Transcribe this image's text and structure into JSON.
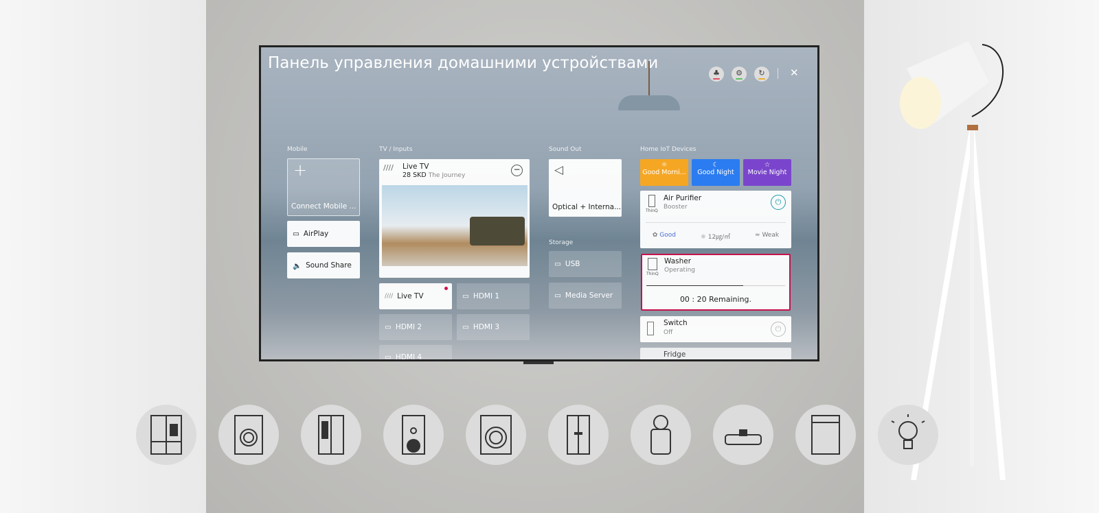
{
  "header": {
    "title": "Панель управления домашними устройствами",
    "icons": [
      {
        "name": "user-settings-icon",
        "color": "#e05060"
      },
      {
        "name": "gear-icon",
        "color": "#5cc060"
      },
      {
        "name": "refresh-icon",
        "color": "#e8b030"
      }
    ],
    "close": "✕"
  },
  "mobile": {
    "label": "Mobile",
    "connect": "Connect Mobile ...",
    "airplay": "AirPlay",
    "sound_share": "Sound Share"
  },
  "tv": {
    "label": "TV / Inputs",
    "live_title": "Live TV",
    "channel": "28 SKD",
    "program": "The Journey",
    "inputs": [
      "Live TV",
      "HDMI 1",
      "HDMI 2",
      "HDMI 3",
      "HDMI 4"
    ],
    "active_dot_color": "#d0104c"
  },
  "sound": {
    "label": "Sound Out",
    "output": "Optical + Interna..."
  },
  "storage": {
    "label": "Storage",
    "items": [
      "USB",
      "Media Server"
    ]
  },
  "iot": {
    "label": "Home IoT Devices",
    "scenes": [
      {
        "label": "Good Morni...",
        "color": "#f5a623",
        "icon": "sun-icon"
      },
      {
        "label": "Good Night",
        "color": "#2b7cf0",
        "icon": "moon-icon"
      },
      {
        "label": "Movie Night",
        "color": "#7a45cc",
        "icon": "star-icon"
      }
    ],
    "air_purifier": {
      "name": "Air Purifier",
      "mode": "Booster",
      "quality": "Good",
      "pm": "12㎍/㎥",
      "fan": "Weak",
      "thinq": "ThinQ"
    },
    "washer": {
      "name": "Washer",
      "state": "Operating",
      "remaining": "00 : 20 Remaining.",
      "progress": 0.7,
      "thinq": "ThinQ",
      "highlight": "#c8104c"
    },
    "switch": {
      "name": "Switch",
      "state": "Off"
    },
    "fridge": {
      "name": "Fridge"
    }
  },
  "appliances": [
    "fridge-icon",
    "washer-icon",
    "double-door-fridge-icon",
    "speaker-icon",
    "front-load-washer-icon",
    "styler-icon",
    "robot-air-purifier-icon",
    "robot-vacuum-icon",
    "dishwasher-icon",
    "light-bulb-icon"
  ]
}
